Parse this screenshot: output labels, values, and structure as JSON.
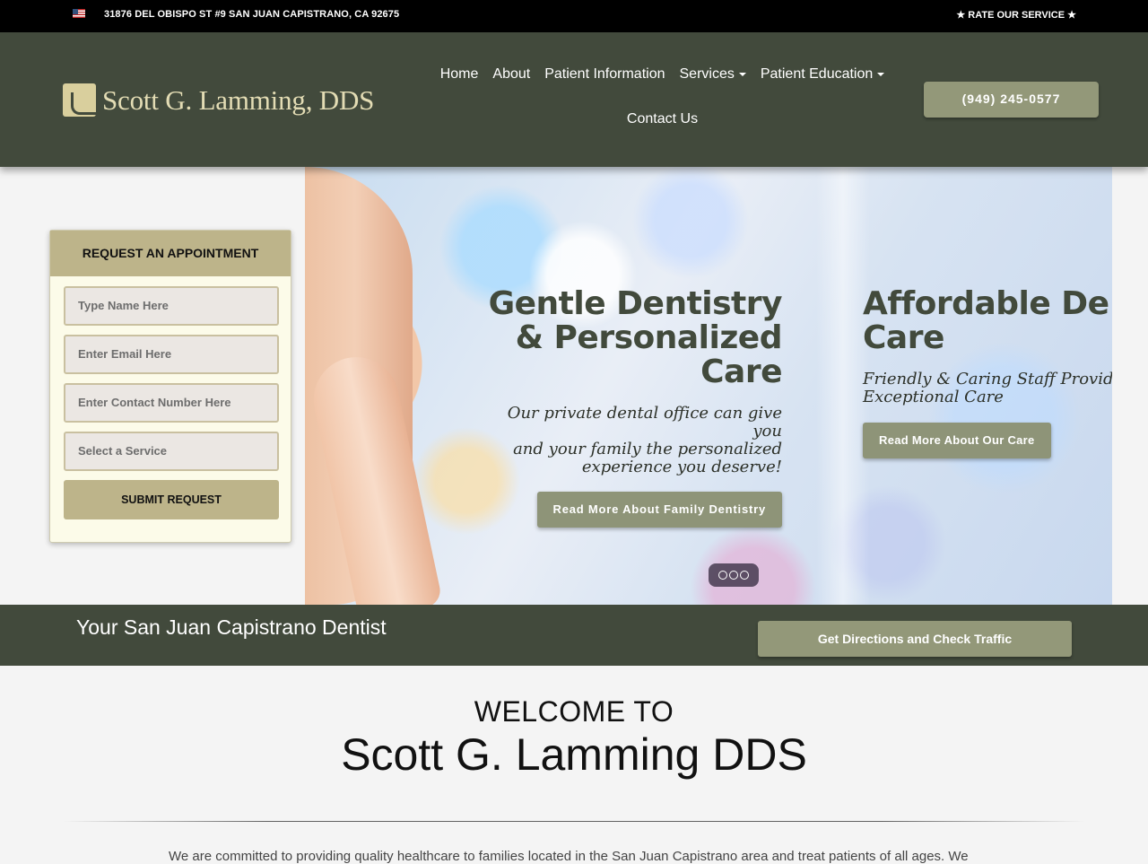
{
  "topbar": {
    "flag_icon": "us-flag-icon",
    "address": "31876 DEL OBISPO ST #9 SAN JUAN CAPISTRANO, CA 92675",
    "rate": "★ RATE OUR SERVICE ★"
  },
  "header": {
    "logo_text": "Scott G. Lamming, DDS",
    "nav": {
      "home": "Home",
      "about": "About",
      "patient_info": "Patient Information",
      "services": "Services",
      "patient_education": "Patient Education",
      "contact": "Contact Us"
    },
    "phone": "(949) 245-0577"
  },
  "appointment": {
    "title": "REQUEST AN APPOINTMENT",
    "name_placeholder": "Type Name Here",
    "email_placeholder": "Enter Email Here",
    "phone_placeholder": "Enter Contact Number Here",
    "service_placeholder": "Select a Service",
    "submit": "SUBMIT REQUEST"
  },
  "hero": {
    "slide1": {
      "line1": "Gentle Dentistry",
      "line2": "& Personalized",
      "line3": "Care",
      "sub1": "Our private dental office can give you",
      "sub2": "and your family the personalized",
      "sub3": "experience you deserve!",
      "button": "Read More About Family Dentistry"
    },
    "slide2": {
      "line1": "Affordable De",
      "line2": "Care",
      "sub1": "Friendly & Caring Staff Providing",
      "sub2": "Exceptional Care",
      "button": "Read More About Our Care"
    }
  },
  "bar": {
    "title": "Your San Juan Capistrano Dentist",
    "directions": "Get Directions and Check Traffic"
  },
  "welcome": {
    "small": "WELCOME TO",
    "big": "Scott G. Lamming DDS",
    "intro": "We are committed to providing quality healthcare to families located in the San Juan Capistrano area and treat patients of all ages. We"
  },
  "colors": {
    "header_bg": "#424a3c",
    "button_green": "#939879",
    "form_gold": "#bdb48a",
    "logo_text": "#e3dcb4"
  }
}
